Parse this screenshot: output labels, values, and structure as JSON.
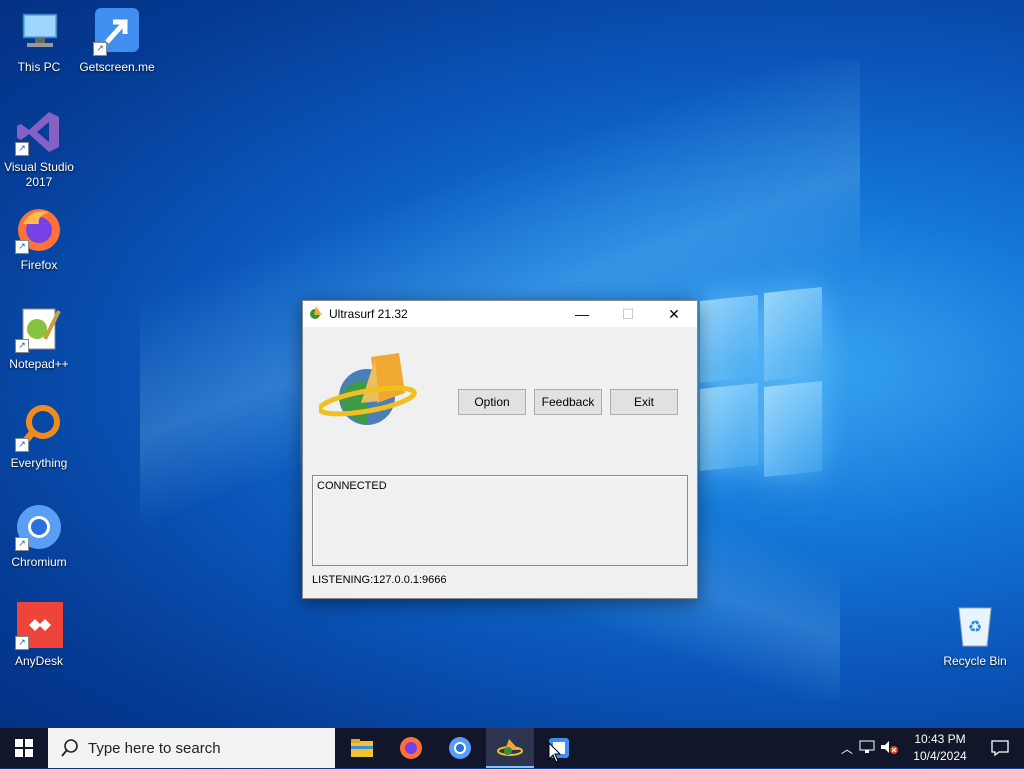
{
  "desktop": {
    "icons": [
      {
        "label": "This PC"
      },
      {
        "label": "Getscreen.me"
      },
      {
        "label": "Visual Studio 2017"
      },
      {
        "label": "Firefox"
      },
      {
        "label": "Notepad++"
      },
      {
        "label": "Everything"
      },
      {
        "label": "Chromium"
      },
      {
        "label": "AnyDesk"
      },
      {
        "label": "Recycle Bin"
      }
    ]
  },
  "window": {
    "title": "Ultrasurf 21.32",
    "buttons": {
      "option": "Option",
      "feedback": "Feedback",
      "exit": "Exit"
    },
    "status_text": "CONNECTED",
    "listening_text": "LISTENING:127.0.0.1:9666"
  },
  "taskbar": {
    "search_placeholder": "Type here to search",
    "clock_time": "10:43 PM",
    "clock_date": "10/4/2024"
  },
  "colors": {
    "accent": "#0078d7",
    "taskbar": "#11162a"
  }
}
